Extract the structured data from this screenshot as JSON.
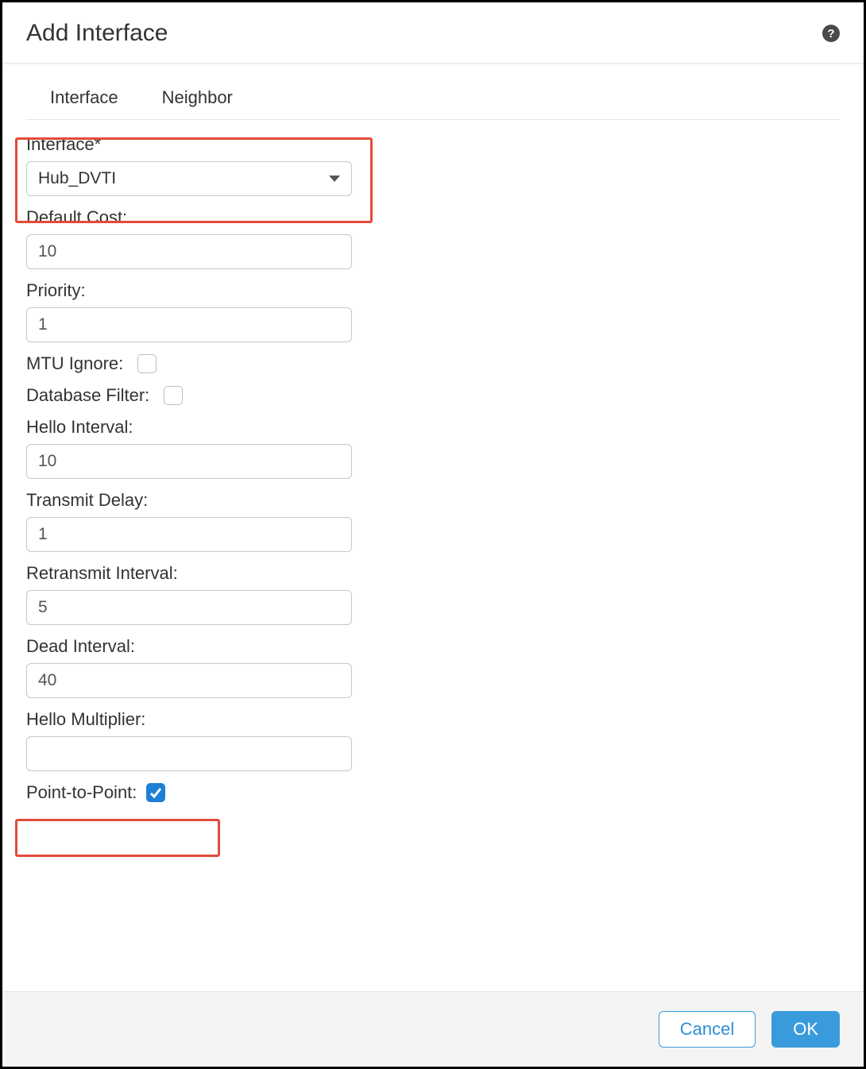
{
  "dialog": {
    "title": "Add Interface",
    "helpIcon": "?"
  },
  "tabs": {
    "interface": "Interface",
    "neighbor": "Neighbor"
  },
  "form": {
    "interfaceLabel": "Interface*",
    "interfaceValue": "Hub_DVTI",
    "defaultCostLabel": "Default Cost:",
    "defaultCostValue": "10",
    "priorityLabel": "Priority:",
    "priorityValue": "1",
    "mtuIgnoreLabel": "MTU Ignore:",
    "mtuIgnoreChecked": false,
    "databaseFilterLabel": "Database Filter:",
    "databaseFilterChecked": false,
    "helloIntervalLabel": "Hello Interval:",
    "helloIntervalValue": "10",
    "transmitDelayLabel": "Transmit Delay:",
    "transmitDelayValue": "1",
    "retransmitIntervalLabel": "Retransmit Interval:",
    "retransmitIntervalValue": "5",
    "deadIntervalLabel": "Dead Interval:",
    "deadIntervalValue": "40",
    "helloMultiplierLabel": "Hello Multiplier:",
    "helloMultiplierValue": "",
    "pointToPointLabel": "Point-to-Point:",
    "pointToPointChecked": true
  },
  "footer": {
    "cancel": "Cancel",
    "ok": "OK"
  }
}
